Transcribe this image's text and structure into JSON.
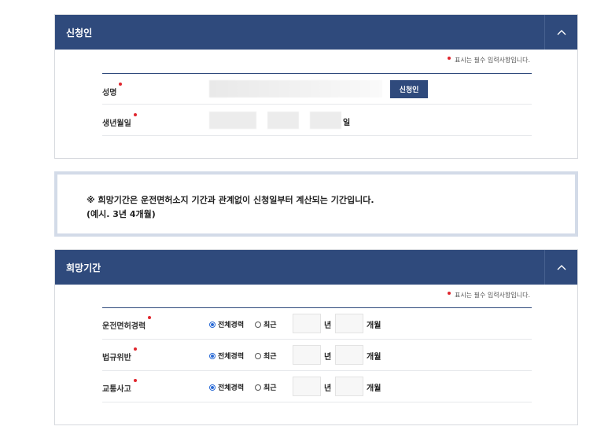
{
  "applicant_panel": {
    "title": "신청인",
    "required_note": "표시는 필수 입력사항입니다.",
    "name_label": "성명",
    "apply_button": "신청인",
    "birth_label": "생년월일",
    "day_suffix": "일"
  },
  "notice": {
    "line1": "※ 희망기간은 운전면허소지 기간과 관계없이 신청일부터 계산되는 기간입니다.",
    "line2": "(예시. 3년 4개월)"
  },
  "period_panel": {
    "title": "희망기간",
    "required_note": "표시는 필수 입력사항입니다.",
    "rows": [
      {
        "label": "운전면허경력",
        "option_all": "전체경력",
        "option_recent": "최근",
        "year_unit": "년",
        "month_unit": "개월",
        "selected": "전체경력"
      },
      {
        "label": "법규위반",
        "option_all": "전체경력",
        "option_recent": "최근",
        "year_unit": "년",
        "month_unit": "개월",
        "selected": "전체경력"
      },
      {
        "label": "교통사고",
        "option_all": "전체경력",
        "option_recent": "최근",
        "year_unit": "년",
        "month_unit": "개월",
        "selected": "전체경력"
      }
    ]
  },
  "colors": {
    "header": "#2f4a7c",
    "required": "#e0262e",
    "notice_border": "#d3dbe8",
    "radio_on": "#2b6bd6"
  },
  "icons": {
    "collapse": "chevron-up-icon",
    "required_marker": "red-dot-icon"
  }
}
